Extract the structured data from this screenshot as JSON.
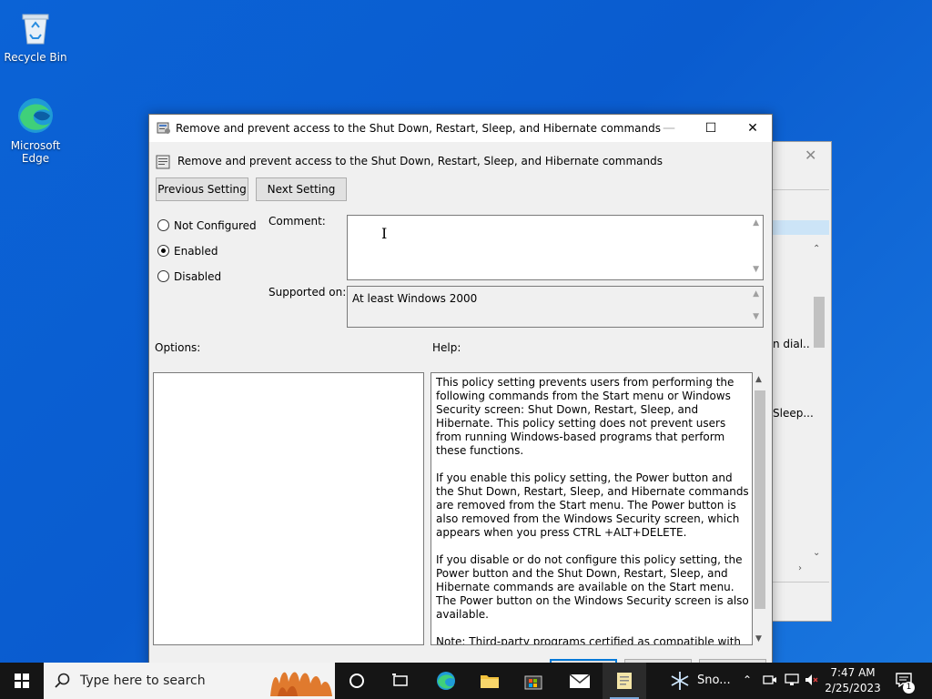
{
  "desktop": {
    "icons": [
      {
        "label": "Recycle Bin",
        "icon": "recycle-bin-icon"
      },
      {
        "label": "Microsoft Edge",
        "icon": "edge-icon"
      }
    ]
  },
  "background_window": {
    "fragment_1": "n dial...",
    "fragment_2": "Sleep..."
  },
  "dialog": {
    "title": "Remove and prevent access to the Shut Down, Restart, Sleep, and Hibernate commands",
    "heading": "Remove and prevent access to the Shut Down, Restart, Sleep, and Hibernate commands",
    "prev_button": "Previous Setting",
    "next_button": "Next Setting",
    "radios": {
      "not_configured": "Not Configured",
      "enabled": "Enabled",
      "disabled": "Disabled",
      "selected": "Enabled"
    },
    "comment_label": "Comment:",
    "comment_value": "",
    "supported_label": "Supported on:",
    "supported_value": "At least Windows 2000",
    "options_label": "Options:",
    "help_label": "Help:",
    "help_text": "This policy setting prevents users from performing the following commands from the Start menu or Windows Security screen: Shut Down, Restart, Sleep, and Hibernate. This policy setting does not prevent users from running Windows-based programs that perform these functions.\n\nIf you enable this policy setting, the Power button and the Shut Down, Restart, Sleep, and Hibernate commands are removed from the Start menu. The Power button is also removed from the Windows Security screen, which appears when you press CTRL +ALT+DELETE.\n\nIf you disable or do not configure this policy setting, the Power button and the Shut Down, Restart, Sleep, and Hibernate commands are available on the Start menu. The Power button on the Windows Security screen is also available.\n\nNote: Third-party programs certified as compatible with Microsoft Windows Vista, Windows XP SP2, Windows XP SP1, Windows XP, or Windows 2000 Professional are required to"
  },
  "taskbar": {
    "search_placeholder": "Type here to search",
    "snow_label": "Sno...",
    "time": "7:47 AM",
    "date": "2/25/2023",
    "notification_count": "1"
  },
  "colors": {
    "desktop": "#0a5ccf",
    "taskbar": "#151515",
    "accent": "#0078d7"
  }
}
